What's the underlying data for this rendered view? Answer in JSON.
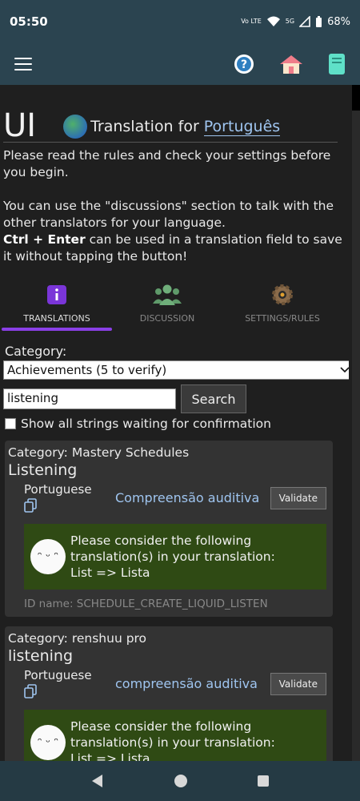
{
  "status": {
    "time": "05:50",
    "volte": "Vo LTE",
    "network": "5G",
    "battery": "68%"
  },
  "header": {
    "colors": {
      "bar": "#2b4450"
    }
  },
  "title": {
    "main": "UI",
    "translation_prefix": "Translation for",
    "language": "Português"
  },
  "intro": {
    "p1": "Please read the rules and check your settings before you begin.",
    "p2": "You can use the \"discussions\" section to talk with the other translators for your language.",
    "p3_bold": "Ctrl + Enter",
    "p3_rest": "can be used in a translation field to save it without tapping the button!"
  },
  "tabs": [
    {
      "label": "TRANSLATIONS",
      "icon": "info-icon"
    },
    {
      "label": "DISCUSSION",
      "icon": "people-icon"
    },
    {
      "label": "SETTINGS/RULES",
      "icon": "gear-icon"
    }
  ],
  "filters": {
    "category_label": "Category:",
    "category_value": "Achievements (5 to verify)",
    "search_value": "listening",
    "search_button": "Search",
    "checkbox_label": "Show all strings waiting for confirmation"
  },
  "cards": [
    {
      "category": "Category: Mastery Schedules",
      "string": "Listening",
      "lang": "Portuguese",
      "value": "Compreensão auditiva",
      "validate": "Validate",
      "hint_line1": "Please consider the following translation(s) in your translation:",
      "hint_line2": "List => Lista",
      "id_name": "ID name: SCHEDULE_CREATE_LIQUID_LISTEN"
    },
    {
      "category": "Category: renshuu pro",
      "string": "listening",
      "lang": "Portuguese",
      "value": "compreensão auditiva",
      "validate": "Validate",
      "hint_line1": "Please consider the following translation(s) in your translation:",
      "hint_line2": "List => Lista"
    }
  ],
  "face_text": "ᵔ ᵕ ᵔ"
}
